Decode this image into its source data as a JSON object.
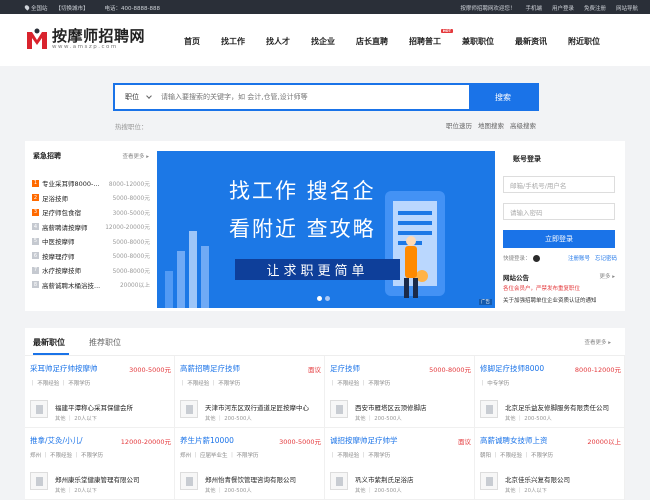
{
  "topbar": {
    "location": "全国站",
    "switch_city": "【切换城市】",
    "phone": "电话：400-8888-888",
    "welcome": "按摩师招聘网欢迎您！",
    "links": [
      "手机端",
      "用户登录",
      "免费注册",
      "网站导航"
    ]
  },
  "logo": {
    "title": "按摩师招聘网",
    "sub": "www.amszp.com"
  },
  "nav": {
    "items": [
      "首页",
      "找工作",
      "找人才",
      "找企业",
      "店长直聘",
      "招聘普工",
      "兼职职位",
      "最新资讯",
      "附近职位"
    ],
    "hot_badge": "HOT"
  },
  "search": {
    "category": "职位",
    "placeholder": "请输入要搜索的关键字，如 会计,仓管,设计师等",
    "button": "搜索",
    "hot_label": "热搜职位：",
    "links": [
      "职位速历",
      "地图搜索",
      "高级搜索"
    ]
  },
  "urgent": {
    "title": "紧急招聘",
    "more": "查看更多 ▸",
    "items": [
      {
        "rank": "1",
        "name": "专业采耳师8000-...",
        "salary": "8000-12000元"
      },
      {
        "rank": "2",
        "name": "足浴技师",
        "salary": "5000-8000元"
      },
      {
        "rank": "3",
        "name": "足疗师包食宿",
        "salary": "3000-5000元"
      },
      {
        "rank": "4",
        "name": "高薪聘请按摩师",
        "salary": "12000-20000元"
      },
      {
        "rank": "5",
        "name": "中医按摩师",
        "salary": "5000-8000元"
      },
      {
        "rank": "6",
        "name": "按摩理疗师",
        "salary": "5000-8000元"
      },
      {
        "rank": "7",
        "name": "水疗按摩技师",
        "salary": "5000-8000元"
      },
      {
        "rank": "8",
        "name": "高薪诚聘木桶浴技...",
        "salary": "20000以上"
      }
    ],
    "colors": {
      "top": "#ff6a00",
      "normal": "#c5c9d0"
    }
  },
  "banner": {
    "line1": "找工作  搜名企",
    "line2": "看附近  查攻略",
    "slogan": "让求职更简单",
    "badge": "广告"
  },
  "login": {
    "title": "账号登录",
    "user_placeholder": "邮箱/手机号/用户名",
    "pass_placeholder": "请输入密码",
    "button": "立即登录",
    "quick": "快捷登录：",
    "register": "注册账号",
    "forgot": "忘记密码"
  },
  "notice": {
    "title": "网站公告",
    "more": "更多 ▸",
    "line1": "各位会员户，严禁发布重复职位",
    "line2": "关于加强招聘单位企业资质认证的通知"
  },
  "jobs": {
    "tab_active": "最新职位",
    "tab2": "推荐职位",
    "more": "查看更多 ▸",
    "cards": [
      {
        "title": "采耳帅足疗帅按摩帅",
        "salary": "3000-5000元",
        "tags": "｜ 不限经验 ｜ 不限学历",
        "company": "福建平潭称心采耳保健会所",
        "meta": "其他 ｜ 20人以下"
      },
      {
        "title": "高薪招聘足疗技师",
        "salary": "面议",
        "tags": "｜ 不限经验 ｜ 不限学历",
        "company": "天津市河东区双行道道足匠按摩中心",
        "meta": "其他 ｜ 200-500人"
      },
      {
        "title": "足疗技师",
        "salary": "5000-8000元",
        "tags": "｜ 不限经验 ｜ 不限学历",
        "company": "西安市雁塔区云顶修脚店",
        "meta": "其他 ｜ 200-500人"
      },
      {
        "title": "修脚足疗技师8000",
        "salary": "8000-12000元",
        "tags": "｜ 中专学历",
        "company": "北京足乐益友修脚服务有限责任公司",
        "meta": "其他 ｜ 200-500人"
      },
      {
        "title": "推拿/艾灸/小儿/",
        "salary": "12000-20000元",
        "tags": "郑州 ｜ 不限经验 ｜ 不限学历",
        "company": "郑州康乐堂健康管理有限公司",
        "meta": "其他 ｜ 20人以下"
      },
      {
        "title": "养生片薪10000",
        "salary": "3000-5000元",
        "tags": "郑州 ｜ 应届毕业生 ｜ 不限学历",
        "company": "郑州怡青餐饮管理咨询有限公司",
        "meta": "其他 ｜ 200-500人"
      },
      {
        "title": "诚招按摩帅足疗帅学",
        "salary": "面议",
        "tags": "｜ 不限经验 ｜ 不限学历",
        "company": "巩义市紫荆氏足浴店",
        "meta": "其他 ｜ 200-500人"
      },
      {
        "title": "高薪诚聘女技师上资",
        "salary": "20000以上",
        "tags": "朝阳 ｜ 不限经验 ｜ 不限学历",
        "company": "北京佳乐兴复有限公司",
        "meta": "其他 ｜ 20人以下"
      }
    ]
  }
}
